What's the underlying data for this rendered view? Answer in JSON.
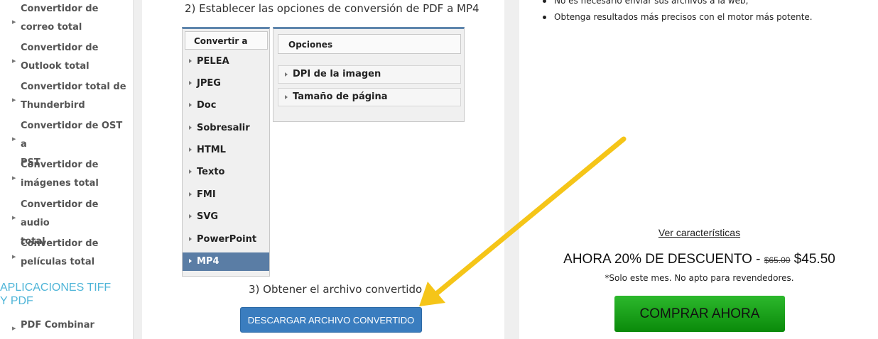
{
  "sidebar": {
    "items": [
      {
        "line1": "Convertidor de",
        "line2": "correo total"
      },
      {
        "line1": "Convertidor de",
        "line2": "Outlook total"
      },
      {
        "line1": "Convertidor total de",
        "line2": "Thunderbird"
      },
      {
        "line1": "Convertidor de OST a",
        "line2": "PST"
      },
      {
        "line1": "Convertidor de",
        "line2": "imágenes total"
      },
      {
        "line1": "Convertidor de audio",
        "line2": "total"
      },
      {
        "line1": "Convertidor de",
        "line2": "películas total"
      }
    ],
    "heading_line1": "APLICACIONES TIFF",
    "heading_line2": "Y PDF",
    "sub_item": "PDF Combinar"
  },
  "center": {
    "step2": "2) Establecer las opciones de conversión de PDF a MP4",
    "convert_header": "Convertir a",
    "formats": [
      "PELEA",
      "JPEG",
      "Doc",
      "Sobresalir",
      "HTML",
      "Texto",
      "FMI",
      "SVG",
      "PowerPoint",
      "MP4"
    ],
    "selected_format": "MP4",
    "options_header": "Opciones",
    "options": [
      "DPI de la imagen",
      "Tamaño de página"
    ],
    "step3": "3) Obtener el archivo convertido",
    "download_button": "DESCARGAR ARCHIVO CONVERTIDO"
  },
  "right": {
    "features": [
      "No es necesario enviar sus archivos a la web;",
      "Obtenga resultados más precisos con el motor más potente."
    ],
    "see_features": "Ver características",
    "discount_text": "AHORA 20% DE DESCUENTO -",
    "old_price": "$65.00",
    "new_price": "$45.50",
    "note": "*Solo este mes. No apto para revendedores.",
    "buy_button": "COMPRAR AHORA"
  },
  "colors": {
    "accent_blue": "#3a7dbf",
    "selected_row": "#5a7da5",
    "buy_green": "#1aa51a",
    "heading_cyan": "#4fb5d8",
    "annotation_arrow": "#f5c518"
  }
}
